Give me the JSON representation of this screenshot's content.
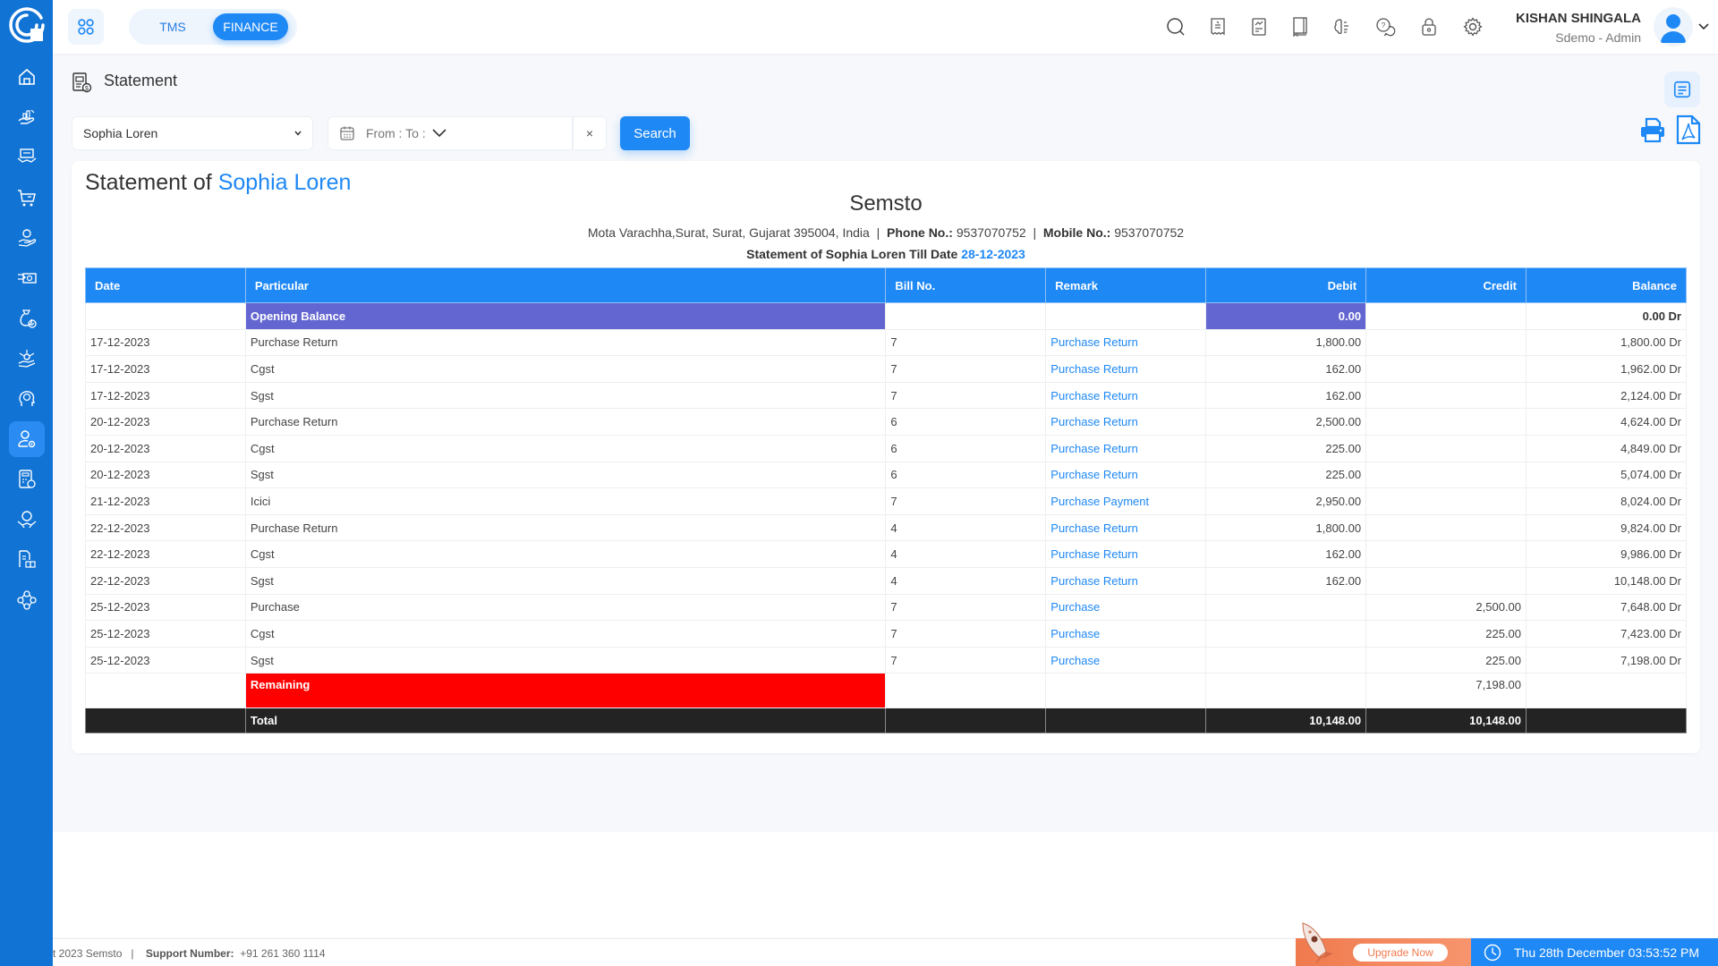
{
  "app": {
    "modules": [
      {
        "label": "TMS",
        "active": false
      },
      {
        "label": "FINANCE",
        "active": true
      }
    ]
  },
  "sidebar": {
    "items": [
      {
        "icon": "home-icon",
        "active": false
      },
      {
        "icon": "sales-chart-icon",
        "active": false
      },
      {
        "icon": "deal-handshake-icon",
        "active": false
      },
      {
        "icon": "cart-icon",
        "active": false
      },
      {
        "icon": "hand-coin-icon",
        "active": false
      },
      {
        "icon": "cash-payment-icon",
        "active": false
      },
      {
        "icon": "money-bag-check-icon",
        "active": false
      },
      {
        "icon": "finance-distribution-icon",
        "active": false
      },
      {
        "icon": "head-idea-icon",
        "active": false
      },
      {
        "icon": "user-settings-icon",
        "active": true
      },
      {
        "icon": "calculator-invoice-icon",
        "active": false
      },
      {
        "icon": "partner-deal-icon",
        "active": false
      },
      {
        "icon": "report-boxes-icon",
        "active": false
      },
      {
        "icon": "network-nodes-icon",
        "active": false
      }
    ]
  },
  "header": {
    "icons": [
      "search-icon",
      "receipt-icon",
      "report-icon",
      "book-icon",
      "ai-brain-icon",
      "help-chat-icon",
      "lock-icon",
      "gear-icon"
    ],
    "user": {
      "name": "KISHAN SHINGALA",
      "role": "Sdemo - Admin"
    }
  },
  "page": {
    "title": "Statement"
  },
  "filters": {
    "party": "Sophia Loren",
    "date_range": "From : To :",
    "clear_label": "×",
    "search_label": "Search"
  },
  "statement": {
    "heading_prefix": "Statement of",
    "party_name": "Sophia Loren",
    "company": "Semsto",
    "address": "Mota Varachha,Surat, Surat, Gujarat 395004, India",
    "phone_label": "Phone No.:",
    "phone": "9537070752",
    "mobile_label": "Mobile No.:",
    "mobile": "9537070752",
    "till_text": "Statement of Sophia Loren Till Date",
    "till_date": "28-12-2023",
    "columns": [
      "Date",
      "Particular",
      "Bill No.",
      "Remark",
      "Debit",
      "Credit",
      "Balance"
    ],
    "opening": {
      "label": "Opening Balance",
      "debit": "0.00",
      "balance": "0.00 Dr"
    },
    "rows": [
      {
        "date": "17-12-2023",
        "particular": "Purchase Return",
        "bill": "7",
        "remark": "Purchase Return",
        "debit": "1,800.00",
        "credit": "",
        "balance": "1,800.00 Dr"
      },
      {
        "date": "17-12-2023",
        "particular": "Cgst",
        "bill": "7",
        "remark": "Purchase Return",
        "debit": "162.00",
        "credit": "",
        "balance": "1,962.00 Dr"
      },
      {
        "date": "17-12-2023",
        "particular": "Sgst",
        "bill": "7",
        "remark": "Purchase Return",
        "debit": "162.00",
        "credit": "",
        "balance": "2,124.00 Dr"
      },
      {
        "date": "20-12-2023",
        "particular": "Purchase Return",
        "bill": "6",
        "remark": "Purchase Return",
        "debit": "2,500.00",
        "credit": "",
        "balance": "4,624.00 Dr"
      },
      {
        "date": "20-12-2023",
        "particular": "Cgst",
        "bill": "6",
        "remark": "Purchase Return",
        "debit": "225.00",
        "credit": "",
        "balance": "4,849.00 Dr"
      },
      {
        "date": "20-12-2023",
        "particular": "Sgst",
        "bill": "6",
        "remark": "Purchase Return",
        "debit": "225.00",
        "credit": "",
        "balance": "5,074.00 Dr"
      },
      {
        "date": "21-12-2023",
        "particular": "Icici",
        "bill": "7",
        "remark": "Purchase Payment",
        "debit": "2,950.00",
        "credit": "",
        "balance": "8,024.00 Dr"
      },
      {
        "date": "22-12-2023",
        "particular": "Purchase Return",
        "bill": "4",
        "remark": "Purchase Return",
        "debit": "1,800.00",
        "credit": "",
        "balance": "9,824.00 Dr"
      },
      {
        "date": "22-12-2023",
        "particular": "Cgst",
        "bill": "4",
        "remark": "Purchase Return",
        "debit": "162.00",
        "credit": "",
        "balance": "9,986.00 Dr"
      },
      {
        "date": "22-12-2023",
        "particular": "Sgst",
        "bill": "4",
        "remark": "Purchase Return",
        "debit": "162.00",
        "credit": "",
        "balance": "10,148.00 Dr"
      },
      {
        "date": "25-12-2023",
        "particular": "Purchase",
        "bill": "7",
        "remark": "Purchase",
        "debit": "",
        "credit": "2,500.00",
        "balance": "7,648.00 Dr"
      },
      {
        "date": "25-12-2023",
        "particular": "Cgst",
        "bill": "7",
        "remark": "Purchase",
        "debit": "",
        "credit": "225.00",
        "balance": "7,423.00 Dr"
      },
      {
        "date": "25-12-2023",
        "particular": "Sgst",
        "bill": "7",
        "remark": "Purchase",
        "debit": "",
        "credit": "225.00",
        "balance": "7,198.00 Dr"
      }
    ],
    "remaining": {
      "label": "Remaining",
      "credit": "7,198.00"
    },
    "total": {
      "label": "Total",
      "debit": "10,148.00",
      "credit": "10,148.00"
    }
  },
  "footer": {
    "copyright": "t 2023 Semsto",
    "support_label": "Support Number:",
    "support_number": "+91 261 360 1114",
    "upgrade_label": "Upgrade Now",
    "datetime": "Thu 28th December 03:53:52 PM"
  },
  "colors": {
    "primary": "#1e88f5",
    "sidebar": "#1173d4",
    "opening_row": "#6366d1",
    "remaining_row": "#ff0000",
    "total_row": "#232323",
    "upgrade": "#f07a4e"
  }
}
